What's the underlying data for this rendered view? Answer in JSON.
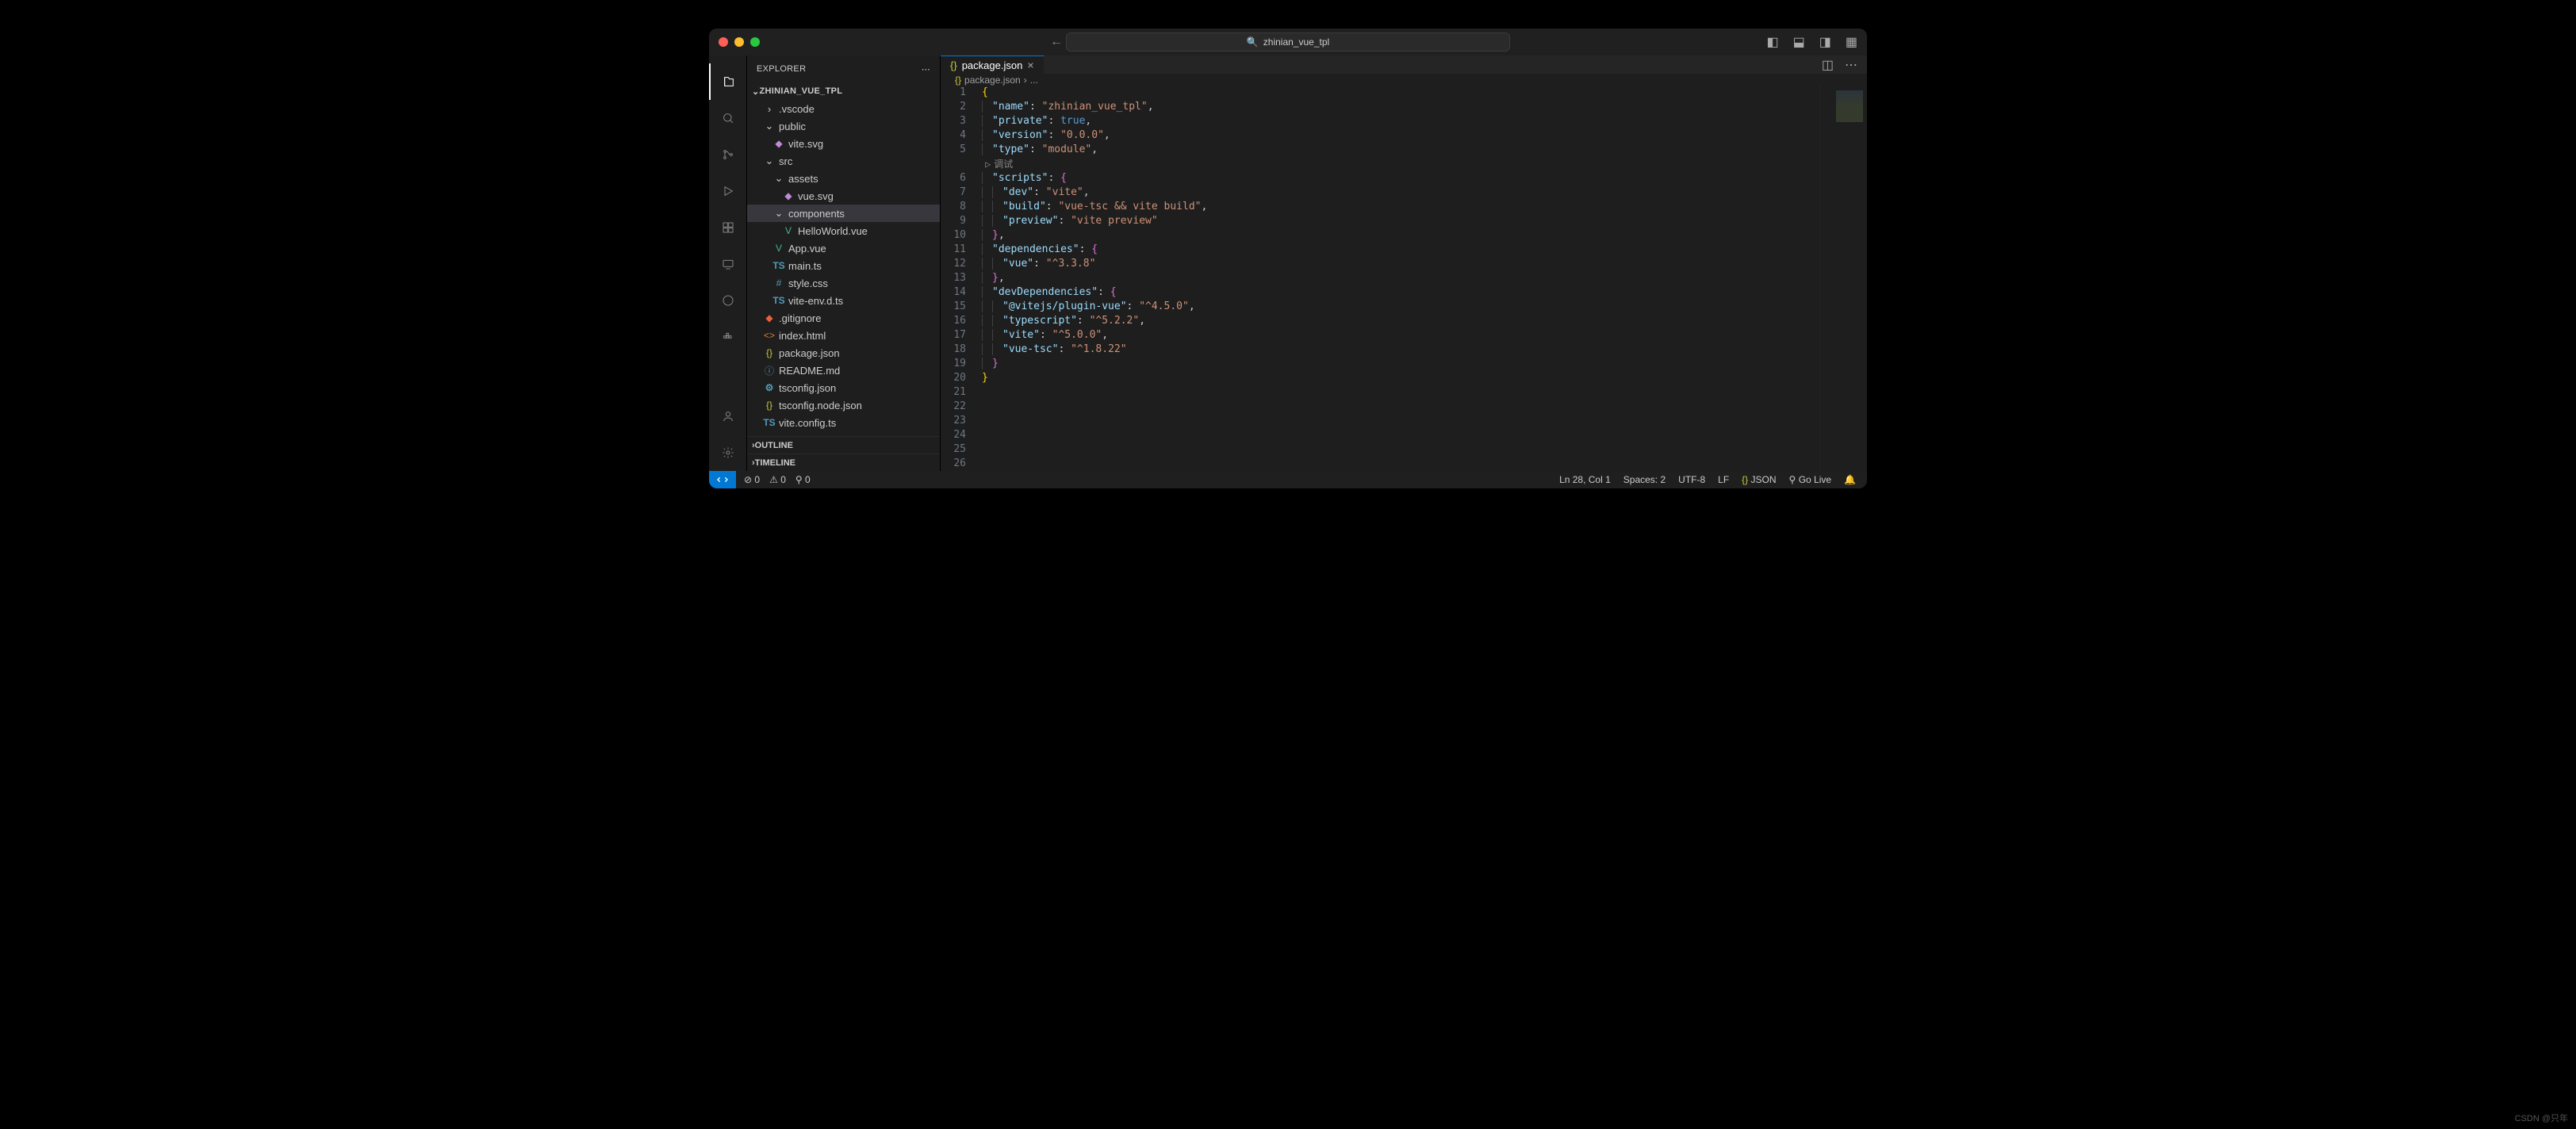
{
  "title": "zhinian_vue_tpl",
  "sidebar": {
    "title": "EXPLORER",
    "folder": "ZHINIAN_VUE_TPL",
    "outline": "OUTLINE",
    "timeline": "TIMELINE",
    "tree": [
      {
        "name": ".vscode",
        "type": "folder",
        "indent": 1,
        "expanded": false
      },
      {
        "name": "public",
        "type": "folder",
        "indent": 1,
        "expanded": true
      },
      {
        "name": "vite.svg",
        "type": "svg",
        "indent": 2
      },
      {
        "name": "src",
        "type": "folder",
        "indent": 1,
        "expanded": true
      },
      {
        "name": "assets",
        "type": "folder",
        "indent": 2,
        "expanded": true
      },
      {
        "name": "vue.svg",
        "type": "svg",
        "indent": 3
      },
      {
        "name": "components",
        "type": "folder",
        "indent": 2,
        "expanded": true,
        "selected": true
      },
      {
        "name": "HelloWorld.vue",
        "type": "vue",
        "indent": 3
      },
      {
        "name": "App.vue",
        "type": "vue",
        "indent": 2
      },
      {
        "name": "main.ts",
        "type": "ts",
        "indent": 2
      },
      {
        "name": "style.css",
        "type": "css",
        "indent": 2
      },
      {
        "name": "vite-env.d.ts",
        "type": "ts",
        "indent": 2
      },
      {
        "name": ".gitignore",
        "type": "git",
        "indent": 1
      },
      {
        "name": "index.html",
        "type": "html",
        "indent": 1
      },
      {
        "name": "package.json",
        "type": "json",
        "indent": 1
      },
      {
        "name": "README.md",
        "type": "md",
        "indent": 1
      },
      {
        "name": "tsconfig.json",
        "type": "tsconfig",
        "indent": 1
      },
      {
        "name": "tsconfig.node.json",
        "type": "json",
        "indent": 1
      },
      {
        "name": "vite.config.ts",
        "type": "ts",
        "indent": 1
      }
    ]
  },
  "tab": {
    "label": "package.json"
  },
  "breadcrumb": {
    "file": "package.json",
    "sep": "›",
    "rest": "..."
  },
  "debug_hint": "调试",
  "code": {
    "name_key": "\"name\"",
    "name_val": "\"zhinian_vue_tpl\"",
    "private_key": "\"private\"",
    "private_val": "true",
    "version_key": "\"version\"",
    "version_val": "\"0.0.0\"",
    "type_key": "\"type\"",
    "type_val": "\"module\"",
    "scripts_key": "\"scripts\"",
    "dev_key": "\"dev\"",
    "dev_val": "\"vite\"",
    "build_key": "\"build\"",
    "build_val": "\"vue-tsc && vite build\"",
    "preview_key": "\"preview\"",
    "preview_val": "\"vite preview\"",
    "deps_key": "\"dependencies\"",
    "vue_key": "\"vue\"",
    "vue_val": "\"^3.3.8\"",
    "devdeps_key": "\"devDependencies\"",
    "plugin_key": "\"@vitejs/plugin-vue\"",
    "plugin_val": "\"^4.5.0\"",
    "tsc_key": "\"typescript\"",
    "tsc_val": "\"^5.2.2\"",
    "vite_key": "\"vite\"",
    "vite_val": "\"^5.0.0\"",
    "vuetsc_key": "\"vue-tsc\"",
    "vuetsc_val": "\"^1.8.22\""
  },
  "status": {
    "errors": "0",
    "warnings": "0",
    "ports": "0",
    "position": "Ln 28, Col 1",
    "spaces": "Spaces: 2",
    "encoding": "UTF-8",
    "eol": "LF",
    "lang": "JSON",
    "golive": "Go Live"
  },
  "watermark": "CSDN @只年"
}
